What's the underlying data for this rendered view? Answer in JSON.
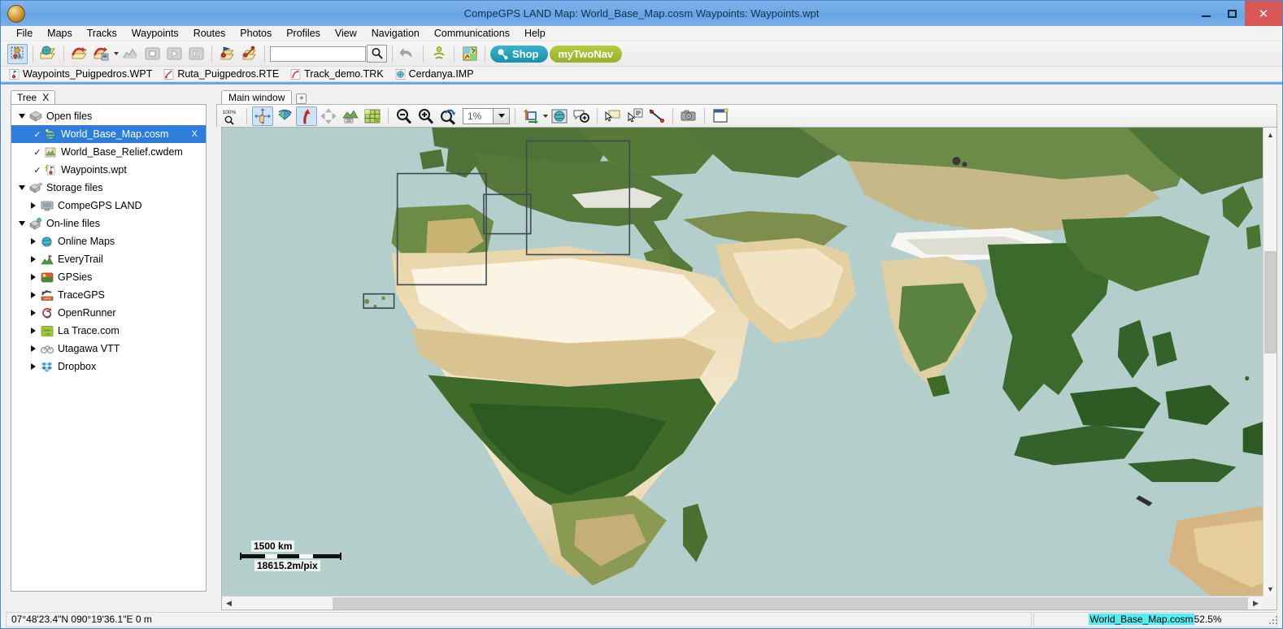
{
  "window": {
    "title": "CompeGPS LAND Map: World_Base_Map.cosm Waypoints:  Waypoints.wpt",
    "minimize_label": "–",
    "maximize_label": "□",
    "close_label": "✕",
    "logo_icon": "compegps-globe-icon"
  },
  "menubar": {
    "items": [
      {
        "label": "File"
      },
      {
        "label": "Maps"
      },
      {
        "label": "Tracks"
      },
      {
        "label": "Waypoints"
      },
      {
        "label": "Routes"
      },
      {
        "label": "Photos"
      },
      {
        "label": "Profiles"
      },
      {
        "label": "View"
      },
      {
        "label": "Navigation"
      },
      {
        "label": "Communications"
      },
      {
        "label": "Help"
      }
    ]
  },
  "toolbar": {
    "search_value": "",
    "search_placeholder": "",
    "search_icon": "magnifier-icon",
    "undo_icon": "undo-arrow-icon",
    "shop_label": "Shop",
    "mytwonav_label": "myTwoNav",
    "buttons": [
      {
        "name": "select-tool-button",
        "icon": "select-waypoint-icon",
        "active": true
      },
      {
        "name": "open-map-button",
        "icon": "open-map-folder-icon"
      },
      {
        "name": "open-track-button",
        "icon": "open-track-folder-icon"
      },
      {
        "name": "open-track-options-button",
        "icon": "open-track-device-icon"
      },
      {
        "name": "graph-button",
        "icon": "elevation-graph-icon"
      },
      {
        "name": "stop-button",
        "icon": "stop-square-icon"
      },
      {
        "name": "play-button",
        "icon": "play-triangle-icon"
      },
      {
        "name": "pause-button",
        "icon": "pause-bars-icon"
      },
      {
        "name": "open-waypoints-button",
        "icon": "open-waypoint-folder-icon"
      },
      {
        "name": "open-routes-button",
        "icon": "open-route-folder-icon"
      },
      {
        "name": "connect-device-button",
        "icon": "wireless-person-icon"
      },
      {
        "name": "legend-button",
        "icon": "map-legend-icon"
      }
    ]
  },
  "openfiles_bar": {
    "items": [
      {
        "label": "Waypoints_Puigpedros.WPT",
        "icon": "waypoint-file-icon"
      },
      {
        "label": "Ruta_Puigpedros.RTE",
        "icon": "route-file-icon"
      },
      {
        "label": "Track_demo.TRK",
        "icon": "track-file-icon"
      },
      {
        "label": "Cerdanya.IMP",
        "icon": "map-file-icon"
      }
    ]
  },
  "tree_panel": {
    "tab_label": "Tree",
    "tab_close_label": "X",
    "nodes": [
      {
        "label": "Open files",
        "indent": 0,
        "twisty": "down",
        "icon": "open-files-icon",
        "checkbox": false,
        "selected": false
      },
      {
        "label": "World_Base_Map.cosm",
        "indent": 1,
        "twisty": "none",
        "icon": "map-cosm-icon",
        "checkbox": true,
        "selected": true,
        "close_label": "X"
      },
      {
        "label": "World_Base_Relief.cwdem",
        "indent": 1,
        "twisty": "none",
        "icon": "relief-cwdem-icon",
        "checkbox": true,
        "selected": false
      },
      {
        "label": "Waypoints.wpt",
        "indent": 1,
        "twisty": "none",
        "icon": "waypoints-wpt-icon",
        "checkbox": true,
        "selected": false
      },
      {
        "label": "Storage files",
        "indent": 0,
        "twisty": "down",
        "icon": "storage-files-icon",
        "checkbox": false,
        "selected": false
      },
      {
        "label": "CompeGPS LAND",
        "indent": 1,
        "twisty": "right",
        "icon": "computer-monitor-icon",
        "checkbox": false,
        "selected": false
      },
      {
        "label": "On-line files",
        "indent": 0,
        "twisty": "down",
        "icon": "online-files-icon",
        "checkbox": false,
        "selected": false
      },
      {
        "label": "Online Maps",
        "indent": 1,
        "twisty": "right",
        "icon": "online-maps-icon",
        "checkbox": false,
        "selected": false
      },
      {
        "label": "EveryTrail",
        "indent": 1,
        "twisty": "right",
        "icon": "everytrail-icon",
        "checkbox": false,
        "selected": false
      },
      {
        "label": "GPSies",
        "indent": 1,
        "twisty": "right",
        "icon": "gpsies-icon",
        "checkbox": false,
        "selected": false
      },
      {
        "label": "TraceGPS",
        "indent": 1,
        "twisty": "right",
        "icon": "tracegps-icon",
        "checkbox": false,
        "selected": false
      },
      {
        "label": "OpenRunner",
        "indent": 1,
        "twisty": "right",
        "icon": "openrunner-icon",
        "checkbox": false,
        "selected": false
      },
      {
        "label": "La Trace.com",
        "indent": 1,
        "twisty": "right",
        "icon": "latrace-icon",
        "checkbox": false,
        "selected": false
      },
      {
        "label": "Utagawa VTT",
        "indent": 1,
        "twisty": "right",
        "icon": "utagawa-icon",
        "checkbox": false,
        "selected": false
      },
      {
        "label": "Dropbox",
        "indent": 1,
        "twisty": "right",
        "icon": "dropbox-icon",
        "checkbox": false,
        "selected": false
      }
    ]
  },
  "map_panel": {
    "tab_label": "Main window",
    "add_tab_label": "+",
    "zoom_value": "1%",
    "zoom_dropdown_icon": "chevron-down-icon",
    "toolbar_buttons": [
      {
        "name": "zoom-100-button",
        "icon": "zoom-100-percent-icon",
        "label": "100%"
      },
      {
        "name": "pan-tool-button",
        "icon": "hand-move-icon",
        "active": true
      },
      {
        "name": "rotate-map-button",
        "icon": "rotate-map-icon"
      },
      {
        "name": "north-up-button",
        "icon": "red-north-arrow-icon"
      },
      {
        "name": "move-map-button",
        "icon": "four-arrows-icon"
      },
      {
        "name": "view-3d-button",
        "icon": "3d-view-icon"
      },
      {
        "name": "grid-button",
        "icon": "grid-squares-icon"
      },
      {
        "name": "zoom-out-button",
        "icon": "magnifier-minus-icon"
      },
      {
        "name": "zoom-in-button",
        "icon": "magnifier-plus-icon"
      },
      {
        "name": "zoom-previous-button",
        "icon": "magnifier-back-arrow-icon"
      },
      {
        "name": "transfer-button",
        "icon": "transfer-arrows-icon"
      },
      {
        "name": "map-globe-button",
        "icon": "globe-square-icon"
      },
      {
        "name": "zoom-area-button",
        "icon": "balloon-zoom-icon"
      },
      {
        "name": "create-note-button",
        "icon": "note-cursor-icon"
      },
      {
        "name": "text-note-button",
        "icon": "text-note-cursor-icon"
      },
      {
        "name": "measure-button",
        "icon": "measure-line-icon"
      },
      {
        "name": "camera-button",
        "icon": "camera-icon"
      },
      {
        "name": "new-window-button",
        "icon": "new-window-icon"
      }
    ],
    "scale": {
      "distance_label": "1500 km",
      "resolution_label": "18615.2m/pix"
    },
    "map_rectangles": [
      {
        "name": "iberia-extent-box"
      },
      {
        "name": "italy-extent-box"
      },
      {
        "name": "balearics-extent-box"
      },
      {
        "name": "canaries-extent-box"
      }
    ]
  },
  "statusbar": {
    "coordinates": "07°48'23.4\"N 090°19'36.1\"E  0 m",
    "map_name": "World_Base_Map.cosm ",
    "map_opacity": "52.5%"
  },
  "colors": {
    "title_bar": "#6da8e6",
    "selection_blue": "#2f7ddb",
    "close_red": "#d75757",
    "shop_teal": "#1790ad",
    "twonav_green": "#95b02c",
    "status_highlight_cyan": "#53eff0",
    "ocean": "#b4cecc"
  }
}
